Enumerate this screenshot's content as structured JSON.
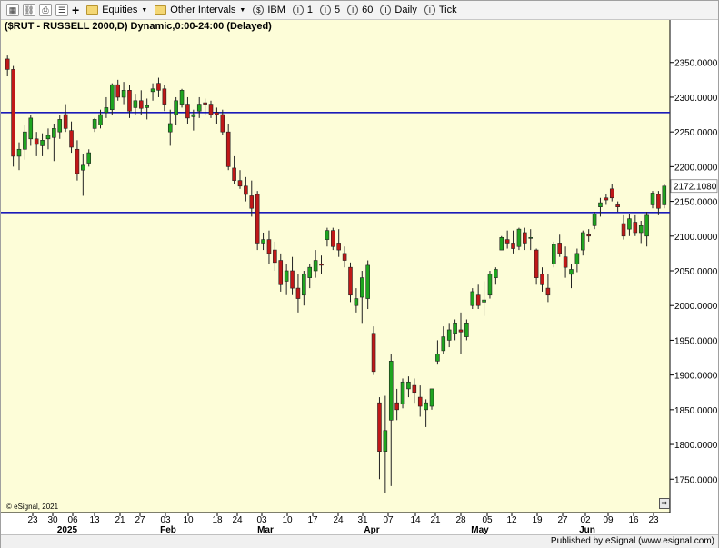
{
  "toolbar": {
    "equities_label": "Equities",
    "other_intervals_label": "Other Intervals",
    "ibm_label": "IBM",
    "interval_1": "1",
    "interval_5": "5",
    "interval_60": "60",
    "daily_label": "Daily",
    "tick_label": "Tick"
  },
  "chart_title": "($RUT - RUSSELL 2000,D) Dynamic,0:00-24:00 (Delayed)",
  "copyright": "© eSignal, 2021",
  "published": "Published by eSignal (www.esignal.com)",
  "colors": {
    "up": "#1fa51f",
    "down": "#c01818",
    "hline": "#1a1ab8",
    "background": "#fdfdd8"
  },
  "chart_data": {
    "type": "candlestick",
    "y_axis": {
      "ticks": [
        "2350.0000",
        "2300.0000",
        "2250.0000",
        "2200.0000",
        "2150.0000",
        "2100.0000",
        "2050.0000",
        "2000.0000",
        "1950.0000",
        "1900.0000",
        "1850.0000",
        "1800.0000",
        "1750.0000"
      ],
      "range": [
        1715,
        2385
      ]
    },
    "last_price": "2172.1080",
    "horizontal_lines": [
      2278,
      2134
    ],
    "x_axis": {
      "day_labels": [
        "23",
        "30",
        "06",
        "13",
        "21",
        "27",
        "03",
        "10",
        "18",
        "24",
        "03",
        "10",
        "17",
        "24",
        "31",
        "07",
        "14",
        "21",
        "28",
        "05",
        "12",
        "19",
        "27",
        "02",
        "09",
        "16",
        "23"
      ],
      "month_labels": [
        "2025",
        "Feb",
        "Mar",
        "Apr",
        "May",
        "Jun"
      ]
    },
    "candles": [
      [
        2355,
        2360,
        2330,
        2340
      ],
      [
        2340,
        2345,
        2200,
        2215
      ],
      [
        2215,
        2235,
        2195,
        2225
      ],
      [
        2225,
        2260,
        2210,
        2250
      ],
      [
        2240,
        2275,
        2230,
        2270
      ],
      [
        2240,
        2250,
        2215,
        2232
      ],
      [
        2230,
        2248,
        2215,
        2238
      ],
      [
        2240,
        2255,
        2225,
        2245
      ],
      [
        2242,
        2262,
        2208,
        2255
      ],
      [
        2250,
        2275,
        2240,
        2268
      ],
      [
        2275,
        2290,
        2250,
        2255
      ],
      [
        2252,
        2265,
        2220,
        2228
      ],
      [
        2225,
        2238,
        2180,
        2190
      ],
      [
        2195,
        2218,
        2158,
        2202
      ],
      [
        2205,
        2225,
        2200,
        2220
      ],
      [
        2255,
        2270,
        2250,
        2268
      ],
      [
        2260,
        2282,
        2255,
        2275
      ],
      [
        2278,
        2300,
        2270,
        2285
      ],
      [
        2282,
        2320,
        2275,
        2318
      ],
      [
        2318,
        2325,
        2295,
        2300
      ],
      [
        2300,
        2322,
        2290,
        2310
      ],
      [
        2310,
        2318,
        2270,
        2280
      ],
      [
        2285,
        2305,
        2275,
        2295
      ],
      [
        2295,
        2310,
        2275,
        2284
      ],
      [
        2285,
        2298,
        2268,
        2288
      ],
      [
        2308,
        2320,
        2295,
        2312
      ],
      [
        2320,
        2328,
        2300,
        2310
      ],
      [
        2312,
        2318,
        2280,
        2290
      ],
      [
        2250,
        2282,
        2230,
        2262
      ],
      [
        2275,
        2300,
        2260,
        2295
      ],
      [
        2290,
        2312,
        2285,
        2310
      ],
      [
        2290,
        2300,
        2262,
        2270
      ],
      [
        2272,
        2282,
        2252,
        2275
      ],
      [
        2280,
        2300,
        2270,
        2290
      ],
      [
        2292,
        2298,
        2275,
        2290
      ],
      [
        2290,
        2295,
        2270,
        2275
      ],
      [
        2278,
        2285,
        2262,
        2275
      ],
      [
        2275,
        2282,
        2245,
        2250
      ],
      [
        2250,
        2262,
        2195,
        2200
      ],
      [
        2198,
        2215,
        2175,
        2180
      ],
      [
        2180,
        2195,
        2168,
        2172
      ],
      [
        2172,
        2185,
        2150,
        2160
      ],
      [
        2158,
        2180,
        2128,
        2140
      ],
      [
        2160,
        2165,
        2080,
        2090
      ],
      [
        2090,
        2105,
        2080,
        2095
      ],
      [
        2095,
        2108,
        2060,
        2075
      ],
      [
        2080,
        2092,
        2050,
        2062
      ],
      [
        2065,
        2075,
        2020,
        2030
      ],
      [
        2035,
        2060,
        2015,
        2050
      ],
      [
        2050,
        2070,
        2015,
        2025
      ],
      [
        2025,
        2045,
        1990,
        2010
      ],
      [
        2015,
        2050,
        2000,
        2045
      ],
      [
        2040,
        2060,
        2025,
        2055
      ],
      [
        2050,
        2080,
        2040,
        2065
      ],
      [
        2060,
        2072,
        2045,
        2058
      ],
      [
        2095,
        2112,
        2085,
        2108
      ],
      [
        2108,
        2112,
        2080,
        2085
      ],
      [
        2090,
        2110,
        2070,
        2080
      ],
      [
        2075,
        2085,
        2055,
        2065
      ],
      [
        2055,
        2062,
        2005,
        2015
      ],
      [
        2000,
        2025,
        1990,
        2010
      ],
      [
        2012,
        2050,
        1975,
        2040
      ],
      [
        2010,
        2065,
        1995,
        2058
      ],
      [
        1960,
        1970,
        1900,
        1905
      ],
      [
        1860,
        1868,
        1750,
        1790
      ],
      [
        1790,
        1870,
        1730,
        1820
      ],
      [
        1835,
        1930,
        1740,
        1920
      ],
      [
        1860,
        1880,
        1835,
        1850
      ],
      [
        1858,
        1895,
        1852,
        1890
      ],
      [
        1880,
        1898,
        1868,
        1890
      ],
      [
        1885,
        1895,
        1860,
        1875
      ],
      [
        1868,
        1885,
        1840,
        1855
      ],
      [
        1850,
        1865,
        1825,
        1860
      ],
      [
        1855,
        1880,
        1850,
        1880
      ],
      [
        1920,
        1950,
        1915,
        1930
      ],
      [
        1935,
        1970,
        1930,
        1955
      ],
      [
        1950,
        1975,
        1940,
        1965
      ],
      [
        1960,
        1980,
        1950,
        1975
      ],
      [
        1965,
        1990,
        1930,
        1962
      ],
      [
        1955,
        1980,
        1950,
        1975
      ],
      [
        2000,
        2025,
        1995,
        2020
      ],
      [
        2015,
        2030,
        1995,
        2000
      ],
      [
        2005,
        2035,
        1985,
        2008
      ],
      [
        2015,
        2050,
        2010,
        2045
      ],
      [
        2040,
        2055,
        2030,
        2052
      ],
      [
        2080,
        2100,
        2080,
        2098
      ],
      [
        2095,
        2108,
        2082,
        2090
      ],
      [
        2090,
        2108,
        2075,
        2082
      ],
      [
        2085,
        2112,
        2080,
        2110
      ],
      [
        2105,
        2112,
        2080,
        2090
      ],
      [
        2098,
        2110,
        2080,
        2098
      ],
      [
        2080,
        2082,
        2030,
        2040
      ],
      [
        2045,
        2055,
        2020,
        2030
      ],
      [
        2025,
        2045,
        2005,
        2015
      ],
      [
        2060,
        2092,
        2055,
        2088
      ],
      [
        2090,
        2102,
        2070,
        2075
      ],
      [
        2070,
        2085,
        2040,
        2055
      ],
      [
        2045,
        2060,
        2025,
        2052
      ],
      [
        2060,
        2082,
        2048,
        2075
      ],
      [
        2080,
        2108,
        2072,
        2105
      ],
      [
        2102,
        2110,
        2092,
        2100
      ],
      [
        2115,
        2135,
        2110,
        2132
      ],
      [
        2142,
        2155,
        2128,
        2148
      ],
      [
        2155,
        2160,
        2145,
        2152
      ],
      [
        2168,
        2175,
        2150,
        2155
      ],
      [
        2145,
        2150,
        2135,
        2142
      ],
      [
        2118,
        2130,
        2095,
        2100
      ],
      [
        2110,
        2132,
        2100,
        2125
      ],
      [
        2120,
        2130,
        2100,
        2105
      ],
      [
        2105,
        2122,
        2090,
        2115
      ],
      [
        2100,
        2135,
        2085,
        2130
      ],
      [
        2145,
        2165,
        2140,
        2162
      ],
      [
        2160,
        2165,
        2130,
        2140
      ],
      [
        2145,
        2175,
        2140,
        2172
      ]
    ]
  }
}
